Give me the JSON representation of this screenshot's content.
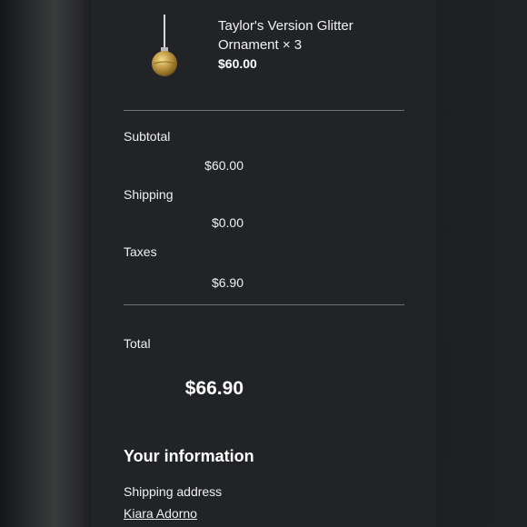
{
  "item": {
    "title": "Taylor's Version Glitter Ornament × 3",
    "price": "$60.00",
    "image_icon": "gold-glitter-ornament"
  },
  "summary": {
    "subtotal_label": "Subtotal",
    "subtotal_value": "$60.00",
    "shipping_label": "Shipping",
    "shipping_value": "$0.00",
    "taxes_label": "Taxes",
    "taxes_value": "$6.90",
    "total_label": "Total",
    "total_value": "$66.90"
  },
  "customer": {
    "section_title": "Your information",
    "shipping_address_label": "Shipping address",
    "name": "Kiara Adorno"
  },
  "colors": {
    "panel_bg": "#212326",
    "divider": "#6e7073",
    "ornament_gold": "#c9a24a"
  }
}
